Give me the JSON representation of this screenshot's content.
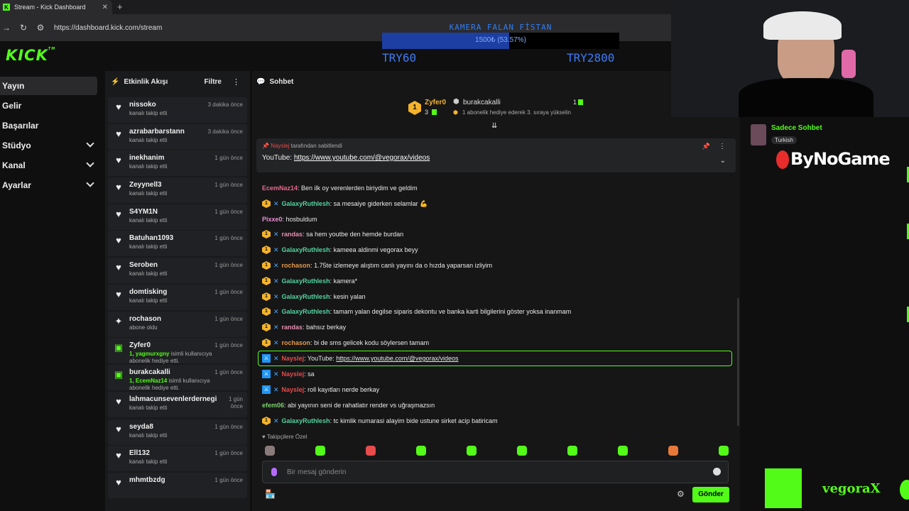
{
  "browser": {
    "tab_title": "Stream - Kick Dashboard",
    "url": "https://dashboard.kick.com/stream"
  },
  "overlay": {
    "goal_title": "KAMERA FALAN FİSTAN",
    "goal_percent_text": "1500₺ (53.57%)",
    "goal_fraction": 0.5357,
    "goal_min": "TRY60",
    "goal_max": "TRY2800"
  },
  "logo": "KICK",
  "nav": [
    {
      "label": "Yayın"
    },
    {
      "label": "Gelir"
    },
    {
      "label": "Başarılar"
    },
    {
      "label": "Stüdyo"
    },
    {
      "label": "Kanal"
    },
    {
      "label": "Ayarlar"
    }
  ],
  "feed": {
    "title": "Etkinlik Akışı",
    "filter": "Filtre",
    "items": [
      {
        "name": "nissoko",
        "action": "kanalı takip etti",
        "time": "3 dakika önce",
        "icon": "heart-icon"
      },
      {
        "name": "azrabarbarstann",
        "action": "kanalı takip etti",
        "time": "3 dakika önce",
        "icon": "heart-icon"
      },
      {
        "name": "inekhanim",
        "action": "kanalı takip etti",
        "time": "1 gün önce",
        "icon": "heart-icon"
      },
      {
        "name": "Zeyynell3",
        "action": "kanalı takip etti",
        "time": "1 gün önce",
        "icon": "heart-icon"
      },
      {
        "name": "S4YM1N",
        "action": "kanalı takip etti",
        "time": "1 gün önce",
        "icon": "heart-icon"
      },
      {
        "name": "Batuhan1093",
        "action": "kanalı takip etti",
        "time": "1 gün önce",
        "icon": "heart-icon"
      },
      {
        "name": "Seroben",
        "action": "kanalı takip etti",
        "time": "1 gün önce",
        "icon": "heart-icon"
      },
      {
        "name": "domtisking",
        "action": "kanalı takip etti",
        "time": "1 gün önce",
        "icon": "heart-icon"
      },
      {
        "name": "rochason",
        "action": "abone oldu",
        "time": "1 gün önce",
        "icon": "sparkle-icon"
      },
      {
        "name": "Zyfer0",
        "action_user": "1, yagmurxgny",
        "action": "isimli kullanıcıya abonelik hediye etti.",
        "time": "1 gün önce",
        "icon": "gift-icon"
      },
      {
        "name": "burakcakalli",
        "action_user": "1, EcemNaz14",
        "action": "isimli kullanıcıya abonelik hediye etti.",
        "time": "1 gün önce",
        "icon": "gift-icon"
      },
      {
        "name": "lahmacunsevenlerdernegi",
        "action": "kanalı takip etti",
        "time": "1 gün önce",
        "icon": "heart-icon"
      },
      {
        "name": "seyda8",
        "action": "kanalı takip etti",
        "time": "1 gün önce",
        "icon": "heart-icon"
      },
      {
        "name": "Ell132",
        "action": "kanalı takip etti",
        "time": "1 gün önce",
        "icon": "heart-icon"
      },
      {
        "name": "mhmtbzdg",
        "action": "",
        "time": "1 gün önce",
        "icon": "heart-icon"
      }
    ]
  },
  "chat": {
    "title": "Sohbet",
    "leaderboard": {
      "first_user": "Zyfer0",
      "first_count": "3",
      "first_rank": "1",
      "second_user": "burakcakalli",
      "second_count": "1",
      "second_note": "1 abonelik hediye ederek 3. sıraya yükselin"
    },
    "pinned": {
      "by_user": "Nayslej",
      "by_text": "tarafından sabitlendi",
      "label": "YouTube:",
      "link": "https://www.youtube.com/@vegorax/videos"
    },
    "messages": [
      {
        "badges": "b1 bs",
        "user": "EcemNaz14",
        "color": "#e56a8c",
        "text": ": Ben ilk oy verenlerden biriydim ve geldim",
        "nobadge": true
      },
      {
        "badges": "b1 bs",
        "user": "GalaxyRuthlesh",
        "color": "#53d3a0",
        "text": ": sa mesaiye giderken selamlar 💪"
      },
      {
        "badges": "",
        "user": "Pixxe0",
        "color": "#e68fd0",
        "text": ": hosbuldum",
        "nobadge": true
      },
      {
        "badges": "b1 bs",
        "user": "randas",
        "color": "#e58fb0",
        "text": ": sa hem youtbe den hemde burdan"
      },
      {
        "badges": "b1 bs",
        "user": "GalaxyRuthlesh",
        "color": "#53d3a0",
        "text": ": kameea aldinmi vegorax beyy"
      },
      {
        "badges": "b1 bs",
        "user": "rochason",
        "color": "#e39a4a",
        "text": ": 1.75te izlemeye alıştım canlı yayını da o hızda yaparsan izliyim"
      },
      {
        "badges": "b1 bs",
        "user": "GalaxyRuthlesh",
        "color": "#53d3a0",
        "text": ": kamera*"
      },
      {
        "badges": "b1 bs",
        "user": "GalaxyRuthlesh",
        "color": "#53d3a0",
        "text": ": kesin yalan"
      },
      {
        "badges": "b1 bs",
        "user": "GalaxyRuthlesh",
        "color": "#53d3a0",
        "text": ": tamam yalan degilse siparis dekontu ve banka karti bilgilerini göster yoksa inanmam"
      },
      {
        "badges": "b1 bs",
        "user": "randas",
        "color": "#e58fb0",
        "text": ": bahsız berkay"
      },
      {
        "badges": "b1 bs",
        "user": "rochason",
        "color": "#e39a4a",
        "text": ": bi de sms gelicek kodu söylersen tamam"
      },
      {
        "badges": "mod bs",
        "user": "Nayslej",
        "color": "#e84b4b",
        "text": ": YouTube: ",
        "link": "https://www.youtube.com/@vegorax/videos"
      },
      {
        "badges": "mod bs",
        "user": "Nayslej",
        "color": "#e84b4b",
        "text": ": sa"
      },
      {
        "badges": "mod bs",
        "user": "Nayslej",
        "color": "#e84b4b",
        "text": ": roll kayıtları nerde berkay"
      },
      {
        "badges": "",
        "user": "efem06",
        "color": "#7ad36b",
        "text": ": abi yayının seni de rahatlatır render vs uğraşmazsın",
        "nobadge": true
      },
      {
        "badges": "b1 bs",
        "user": "GalaxyRuthlesh",
        "color": "#53d3a0",
        "text": ": tc kimlik numarasi alayim bide ustune sirket acip batiricam"
      }
    ],
    "emote_label": "Takipçilere Özel",
    "input_placeholder": "Bir mesaj gönderin",
    "send": "Gönder"
  },
  "right": {
    "chat_mode": "Sadece Sohbet",
    "language_tag": "Turkish",
    "sponsor": "ByNoGame",
    "watermark": "vegoraX"
  },
  "colors": {
    "accent": "#53fc18",
    "goal_blue": "#3a7cf7"
  }
}
